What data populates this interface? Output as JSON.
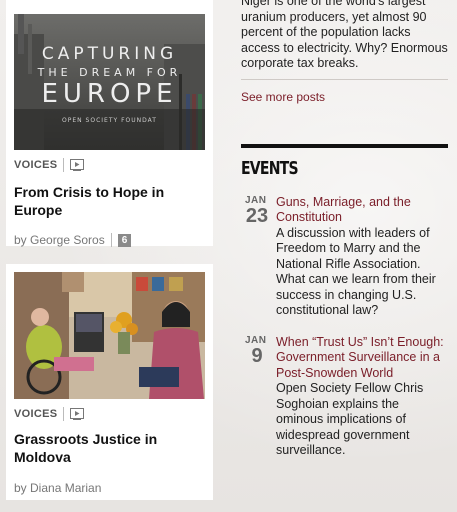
{
  "posts": [
    {
      "thumb": {
        "line1": "CAPTURING",
        "line2": "THE DREAM FOR",
        "line3": "EUROPE",
        "footer": "OPEN SOCIETY FOUNDAT"
      },
      "category": "VOICES",
      "title": "From Crisis to Hope in Europe",
      "byline": "by George Soros",
      "comments": "6"
    },
    {
      "category": "VOICES",
      "title": "Grassroots Justice in Moldova",
      "byline": "by Diana Marian"
    }
  ],
  "sidebar": {
    "intro": "Niger is one of the world's largest uranium producers, yet almost 90 percent of the population lacks access to electricity. Why? Enormous corporate tax breaks.",
    "see_more": "See more posts"
  },
  "events": {
    "heading": "EVENTS",
    "items": [
      {
        "month": "JAN",
        "day": "23",
        "title": "Guns, Marriage, and the Constitution",
        "desc": "A discussion with leaders of Freedom to Marry and the National Rifle Association. What can we learn from their success in changing U.S. constitutional law?"
      },
      {
        "month": "JAN",
        "day": "9",
        "title": "When “Trust Us” Isn’t Enough: Government Surveillance in a Post-Snowden World",
        "desc": "Open Society Fellow Chris Soghoian explains the ominous implications of widespread government surveillance."
      }
    ]
  },
  "colors": {
    "accent": "#7a1d28",
    "badge": "#8a8a8a"
  }
}
